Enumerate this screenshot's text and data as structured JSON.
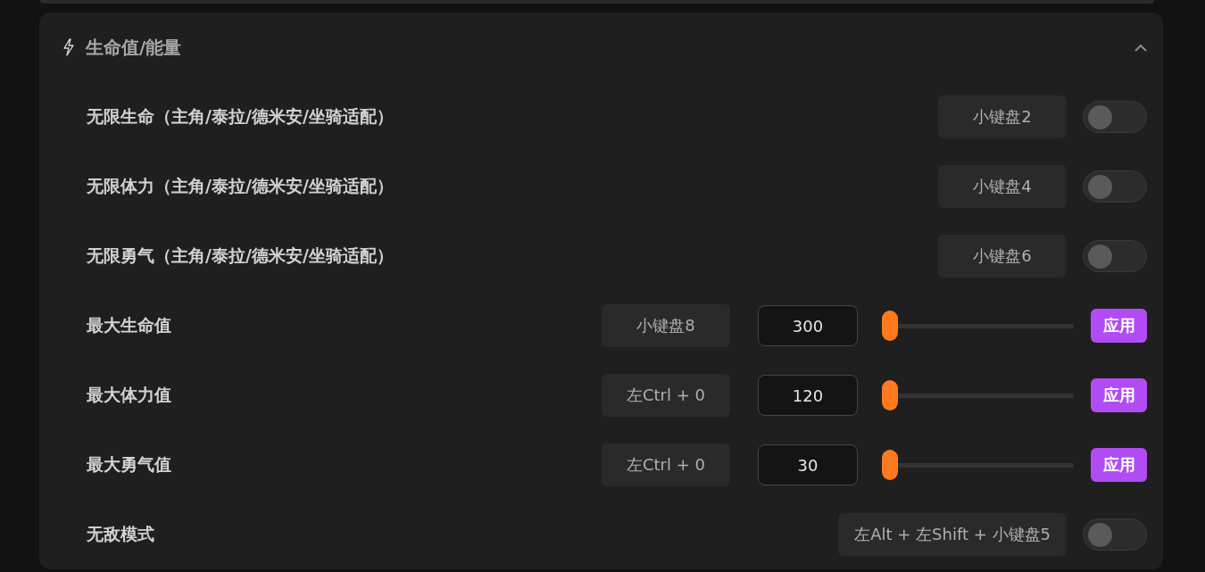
{
  "section": {
    "title": "生命值/能量",
    "expanded": true
  },
  "rows": [
    {
      "kind": "toggle",
      "label": "无限生命（主角/泰拉/德米安/坐骑适配）",
      "hotkey": "小键盘2",
      "on": false
    },
    {
      "kind": "toggle",
      "label": "无限体力（主角/泰拉/德米安/坐骑适配）",
      "hotkey": "小键盘4",
      "on": false
    },
    {
      "kind": "toggle",
      "label": "无限勇气（主角/泰拉/德米安/坐骑适配）",
      "hotkey": "小键盘6",
      "on": false
    },
    {
      "kind": "slider",
      "label": "最大生命值",
      "hotkey": "小键盘8",
      "value": "300",
      "level": 0,
      "button": "应用"
    },
    {
      "kind": "slider",
      "label": "最大体力值",
      "hotkey": "左Ctrl + 0",
      "value": "120",
      "level": 0,
      "button": "应用"
    },
    {
      "kind": "slider",
      "label": "最大勇气值",
      "hotkey": "左Ctrl + 0",
      "value": "30",
      "level": 0,
      "button": "应用"
    },
    {
      "kind": "toggle",
      "label": "无敌模式",
      "hotkey": "左Alt + 左Shift + 小键盘5",
      "on": false
    }
  ]
}
